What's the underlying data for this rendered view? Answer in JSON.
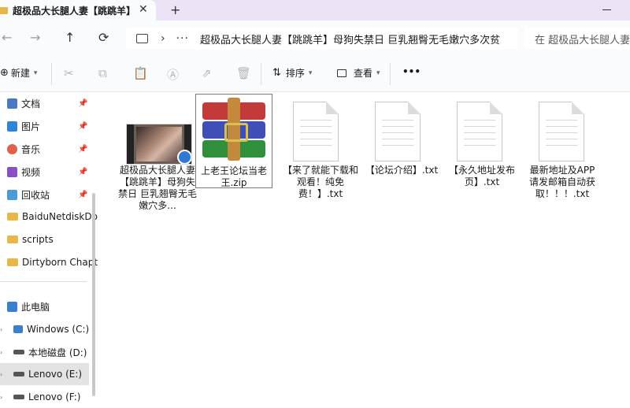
{
  "window": {
    "tab_title": "超极品大长腿人妻【跳跳羊】母",
    "tab_close": "✕",
    "new_tab": "+"
  },
  "nav": {
    "back": "←",
    "forward": "→",
    "up": "↑",
    "refresh": "⟳",
    "address_path": "超极品大长腿人妻【跳跳羊】母狗失禁日 巨乳翘臀无毛嫩穴多次贫才",
    "search_placeholder": "在 超极品大长腿人妻"
  },
  "toolbar": {
    "new_label": "新建",
    "sort_label": "排序",
    "view_label": "查看",
    "more_label": "•••"
  },
  "sidebar": {
    "quick_access": [
      {
        "label": "文档",
        "icon": "documents-icon",
        "color": "#4a78c2"
      },
      {
        "label": "图片",
        "icon": "pictures-icon",
        "color": "#2f86d8"
      },
      {
        "label": "音乐",
        "icon": "music-icon",
        "color": "#e0604a"
      },
      {
        "label": "视频",
        "icon": "videos-icon",
        "color": "#8a4fc7"
      },
      {
        "label": "回收站",
        "icon": "recycle-bin-icon",
        "color": "#4a9bd6"
      }
    ],
    "folders": [
      {
        "label": "BaiduNetdiskDo"
      },
      {
        "label": "scripts"
      },
      {
        "label": "Dirtyborn Chapt"
      }
    ],
    "this_pc": "此电脑",
    "drives": [
      {
        "label": "Windows (C:)"
      },
      {
        "label": "本地磁盘 (D:)"
      },
      {
        "label": "Lenovo (E:)"
      },
      {
        "label": "Lenovo (F:)"
      }
    ]
  },
  "files": [
    {
      "name": "超极品大长腿人妻【跳跳羊】母狗失禁日 巨乳翘臀无毛嫩穴多...",
      "type": "video"
    },
    {
      "name": "上老王论坛当老王.zip",
      "type": "zip"
    },
    {
      "name": "【来了就能下载和观看！纯免费！】.txt",
      "type": "txt"
    },
    {
      "name": "【论坛介绍】.txt",
      "type": "txt"
    },
    {
      "name": "【永久地址发布页】.txt",
      "type": "txt"
    },
    {
      "name": "最新地址及APP请发邮箱自动获取！！！.txt",
      "type": "txt"
    }
  ],
  "colors": {
    "accent": "#2f78d6",
    "folder": "#e9b748",
    "tab_strip": "#ece4f6"
  }
}
